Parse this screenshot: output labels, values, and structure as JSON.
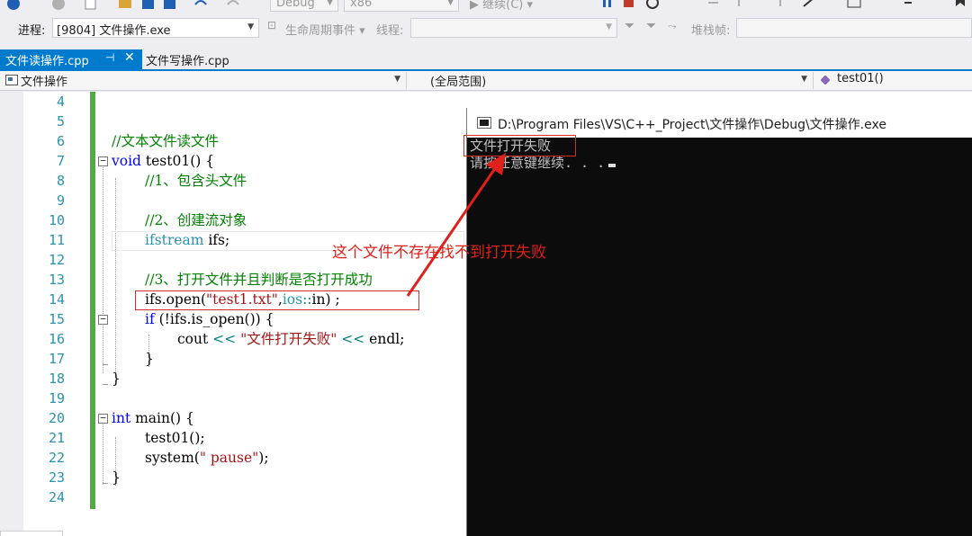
{
  "toolbar": {
    "config_value": "Debug",
    "platform_value": "x86",
    "continue_label": "继续(C)"
  },
  "debug_location": {
    "process_label": "进程:",
    "process_value": "[9804] 文件操作.exe",
    "lifecycle_label": "生命周期事件",
    "thread_label": "线程:",
    "stackframe_label": "堆栈帧:"
  },
  "tabs": [
    {
      "label": "文件读操作.cpp",
      "active": true
    },
    {
      "label": "文件写操作.cpp",
      "active": false
    }
  ],
  "navbar": {
    "project": "文件操作",
    "scope": "(全局范围)",
    "member": "test01()"
  },
  "editor": {
    "line_numbers": [
      "4",
      "5",
      "6",
      "7",
      "8",
      "9",
      "10",
      "11",
      "12",
      "13",
      "14",
      "15",
      "16",
      "17",
      "18",
      "19",
      "20",
      "21",
      "22",
      "23",
      "24"
    ],
    "lines": {
      "l6": "//文本文件读文件",
      "l7_kw": "void",
      "l7_rest": " test01() {",
      "l8": "//1、包含头文件",
      "l10": "//2、创建流对象",
      "l11_type": "ifstream",
      "l11_rest": " ifs;",
      "l13": "//3、打开文件并且判断是否打开成功",
      "l14_a": "ifs.open(",
      "l14_str": "\"test1.txt\"",
      "l14_b": ",",
      "l14_ns": "ios",
      "l14_op": "::",
      "l14_c": "in) ;",
      "l15_kw": "if",
      "l15_rest": " (!ifs.is_open()) {",
      "l16_a": "cout ",
      "l16_op1": "<<",
      "l16_str": " \"文件打开失败\"",
      "l16_op2": " <<",
      "l16_b": " endl;",
      "l17": "}",
      "l18": "}",
      "l20_kw": "int",
      "l20_rest": " main() {",
      "l21": "test01();",
      "l22_a": "system(",
      "l22_str": "\" pause\"",
      "l22_b": ");",
      "l23": "}"
    }
  },
  "console": {
    "title": "D:\\Program Files\\VS\\C++_Project\\文件操作\\Debug\\文件操作.exe",
    "line1": "文件打开失败",
    "line2": "请按任意键继续. . ."
  },
  "annotation": {
    "text": "这个文件不存在找不到打开失败",
    "color": "#e0201b"
  }
}
